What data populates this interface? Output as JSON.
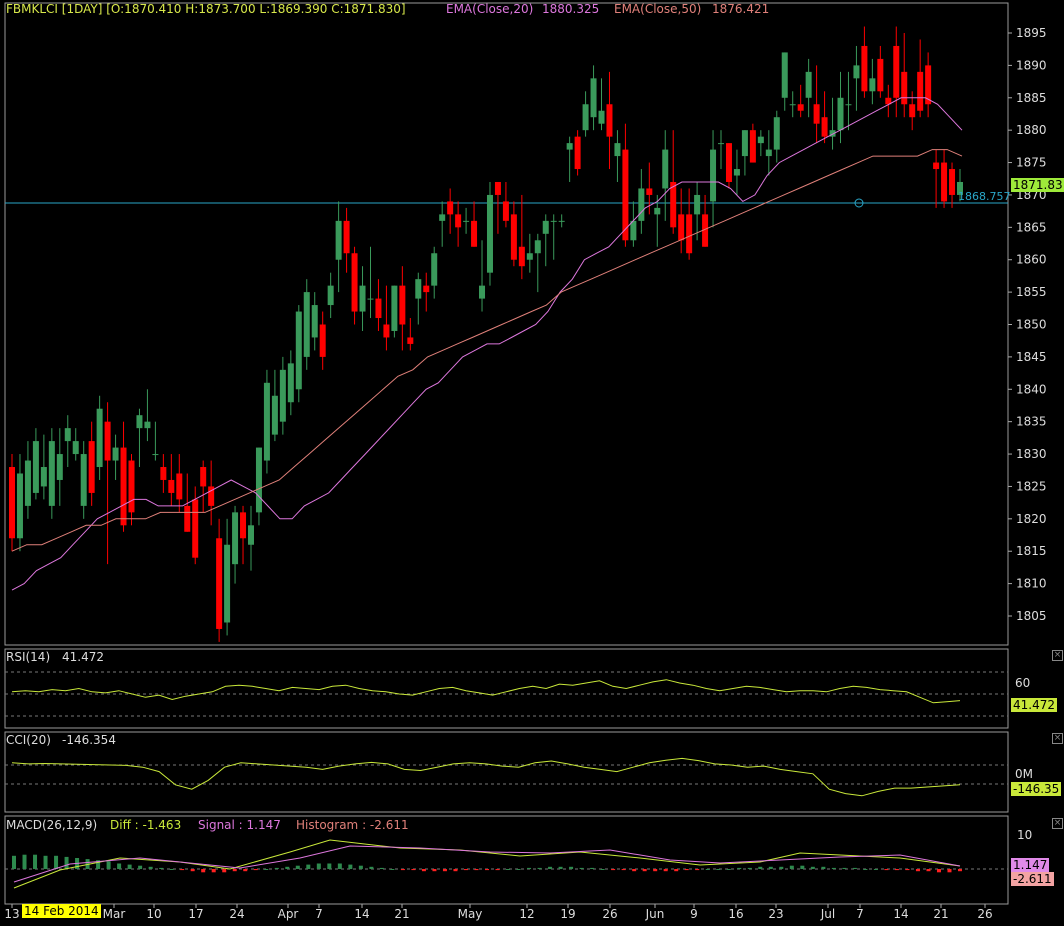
{
  "header": {
    "symbol_ohlc": "FBMKLCI [1DAY] [O:1870.410 H:1873.700 L:1869.390 C:1871.830]",
    "ema20_label": "EMA(Close,20)",
    "ema20_value": "1880.325",
    "ema50_label": "EMA(Close,50)",
    "ema50_value": "1876.421"
  },
  "price_tag": "1871.83",
  "hline_tag": "1868.757",
  "rsi": {
    "label": "RSI(14)",
    "value": "41.472",
    "tick": "60",
    "tag": "41.472"
  },
  "cci": {
    "label": "CCI(20)",
    "value": "-146.354",
    "tick": "0M",
    "tag": "-146.35"
  },
  "macd": {
    "label": "MACD(26,12,9)",
    "diff_label": "Diff : -1.463",
    "signal_label": "Signal : 1.147",
    "hist_label": "Histogram : -2.611",
    "tick": "10",
    "signal_tag": "1.147",
    "diff_tag": "-2.611"
  },
  "date_marker": "14 Feb 2014",
  "colors": {
    "up": "#3a9a5b",
    "down": "#ff0000",
    "ema20": "#dd77dd",
    "ema50": "#e0807a",
    "rsi": "#c9e83a",
    "hline": "#2aa6c8",
    "price_tag": "#9eea3a"
  },
  "chart_data": {
    "type": "candlestick",
    "title": "FBMKLCI [1DAY]",
    "price_axis_ticks": [
      "1895",
      "1890",
      "1885",
      "1880",
      "1875",
      "1870",
      "1865",
      "1860",
      "1855",
      "1850",
      "1845",
      "1840",
      "1835",
      "1830",
      "1825",
      "1820",
      "1815",
      "1810",
      "1805"
    ],
    "date_axis_ticks": [
      "13",
      "Mar",
      "10",
      "17",
      "24",
      "Apr",
      "7",
      "14",
      "21",
      "May",
      "12",
      "19",
      "26",
      "Jun",
      "9",
      "16",
      "23",
      "Jul",
      "7",
      "14",
      "21",
      "26"
    ],
    "ylim": [
      1800,
      1897
    ],
    "horizontal_line": 1868.757,
    "series": [
      {
        "name": "EMA(Close,20)",
        "last": 1880.325
      },
      {
        "name": "EMA(Close,50)",
        "last": 1876.421
      }
    ],
    "ohlc": [
      [
        1828,
        1830,
        1815,
        1817
      ],
      [
        1817,
        1830,
        1815,
        1827
      ],
      [
        1822,
        1832,
        1820,
        1829
      ],
      [
        1824,
        1834,
        1823,
        1832
      ],
      [
        1825,
        1833,
        1823,
        1828
      ],
      [
        1822,
        1834,
        1820,
        1832
      ],
      [
        1826,
        1834,
        1822,
        1830
      ],
      [
        1832,
        1836,
        1828,
        1834
      ],
      [
        1830,
        1834,
        1829,
        1832
      ],
      [
        1822,
        1832,
        1820,
        1830
      ],
      [
        1832,
        1835,
        1822,
        1824
      ],
      [
        1828,
        1839,
        1826,
        1837
      ],
      [
        1835,
        1838,
        1813,
        1829
      ],
      [
        1829,
        1833,
        1826,
        1831
      ],
      [
        1831,
        1835,
        1818,
        1819
      ],
      [
        1829,
        1830,
        1819,
        1821
      ],
      [
        1834,
        1837,
        1828,
        1836
      ],
      [
        1834,
        1840,
        1832,
        1835
      ],
      [
        1830,
        1835,
        1829,
        1830
      ],
      [
        1828,
        1830,
        1824,
        1826
      ],
      [
        1826,
        1830,
        1822,
        1824
      ],
      [
        1827,
        1830,
        1821,
        1823
      ],
      [
        1822,
        1827,
        1818,
        1818
      ],
      [
        1823,
        1825,
        1813,
        1814
      ],
      [
        1828,
        1829,
        1821,
        1825
      ],
      [
        1825,
        1829,
        1819,
        1822
      ],
      [
        1817,
        1820,
        1801,
        1803
      ],
      [
        1804,
        1820,
        1802,
        1816
      ],
      [
        1813,
        1822,
        1810,
        1821
      ],
      [
        1821,
        1822,
        1813,
        1817
      ],
      [
        1816,
        1822,
        1812,
        1819
      ],
      [
        1821,
        1831,
        1819,
        1831
      ],
      [
        1829,
        1843,
        1827,
        1841
      ],
      [
        1833,
        1843,
        1832,
        1839
      ],
      [
        1835,
        1845,
        1833,
        1843
      ],
      [
        1838,
        1846,
        1836,
        1844
      ],
      [
        1840,
        1853,
        1838,
        1852
      ],
      [
        1845,
        1857,
        1843,
        1855
      ],
      [
        1848,
        1855,
        1846,
        1853
      ],
      [
        1850,
        1852,
        1843,
        1845
      ],
      [
        1853,
        1858,
        1851,
        1856
      ],
      [
        1860,
        1869,
        1855,
        1866
      ],
      [
        1866,
        1868,
        1858,
        1861
      ],
      [
        1861,
        1862,
        1850,
        1852
      ],
      [
        1852,
        1859,
        1849,
        1856
      ],
      [
        1854,
        1862,
        1851,
        1854
      ],
      [
        1854,
        1857,
        1849,
        1851
      ],
      [
        1850,
        1856,
        1846,
        1848
      ],
      [
        1849,
        1856,
        1848,
        1856
      ],
      [
        1856,
        1859,
        1846,
        1850
      ],
      [
        1848,
        1851,
        1846,
        1847
      ],
      [
        1854,
        1858,
        1850,
        1857
      ],
      [
        1856,
        1858,
        1852,
        1855
      ],
      [
        1856,
        1862,
        1854,
        1861
      ],
      [
        1866,
        1869,
        1862,
        1867
      ],
      [
        1869,
        1871,
        1864,
        1867
      ],
      [
        1867,
        1869,
        1862,
        1865
      ],
      [
        1866,
        1868,
        1864,
        1866
      ],
      [
        1866,
        1869,
        1862,
        1862
      ],
      [
        1854,
        1863,
        1852,
        1856
      ],
      [
        1858,
        1872,
        1856,
        1870
      ],
      [
        1872,
        1872,
        1864,
        1870
      ],
      [
        1869,
        1872,
        1865,
        1866
      ],
      [
        1867,
        1869,
        1859,
        1860
      ],
      [
        1862,
        1870,
        1857,
        1859
      ],
      [
        1860,
        1864,
        1858,
        1861
      ],
      [
        1861,
        1864,
        1855,
        1863
      ],
      [
        1864,
        1867,
        1859,
        1866
      ],
      [
        1866,
        1867,
        1860,
        1866
      ],
      [
        1866,
        1867,
        1865,
        1866
      ],
      [
        1877,
        1879,
        1872,
        1878
      ],
      [
        1879,
        1880,
        1873,
        1874
      ],
      [
        1880,
        1886,
        1879,
        1884
      ],
      [
        1882,
        1890,
        1880,
        1888
      ],
      [
        1881,
        1888,
        1880,
        1883
      ],
      [
        1884,
        1889,
        1874,
        1879
      ],
      [
        1876,
        1880,
        1872,
        1878
      ],
      [
        1877,
        1881,
        1862,
        1863
      ],
      [
        1863,
        1869,
        1862,
        1866
      ],
      [
        1866,
        1874,
        1864,
        1871
      ],
      [
        1871,
        1875,
        1867,
        1870
      ],
      [
        1867,
        1870,
        1862,
        1868
      ],
      [
        1871,
        1880,
        1866,
        1877
      ],
      [
        1872,
        1880,
        1864,
        1865
      ],
      [
        1867,
        1871,
        1861,
        1863
      ],
      [
        1867,
        1871,
        1860,
        1861
      ],
      [
        1867,
        1872,
        1863,
        1870
      ],
      [
        1867,
        1870,
        1862,
        1862
      ],
      [
        1869,
        1880,
        1865,
        1877
      ],
      [
        1878,
        1880,
        1874,
        1878
      ],
      [
        1878,
        1878,
        1871,
        1872
      ],
      [
        1873,
        1877,
        1870,
        1874
      ],
      [
        1876,
        1880,
        1873,
        1880
      ],
      [
        1880,
        1881,
        1875,
        1875
      ],
      [
        1878,
        1880,
        1876,
        1879
      ],
      [
        1876,
        1880,
        1873,
        1877
      ],
      [
        1877,
        1883,
        1875,
        1882
      ],
      [
        1885,
        1892,
        1883,
        1892
      ],
      [
        1884,
        1886,
        1882,
        1884
      ],
      [
        1884,
        1887,
        1882,
        1883
      ],
      [
        1885,
        1891,
        1882,
        1889
      ],
      [
        1884,
        1890,
        1878,
        1881
      ],
      [
        1882,
        1886,
        1878,
        1879
      ],
      [
        1879,
        1885,
        1877,
        1880
      ],
      [
        1880,
        1889,
        1878,
        1885
      ],
      [
        1884,
        1889,
        1880,
        1884
      ],
      [
        1888,
        1893,
        1883,
        1890
      ],
      [
        1893,
        1896,
        1885,
        1886
      ],
      [
        1886,
        1891,
        1884,
        1888
      ],
      [
        1891,
        1893,
        1885,
        1886
      ],
      [
        1885,
        1887,
        1882,
        1884
      ],
      [
        1893,
        1896,
        1882,
        1885
      ],
      [
        1889,
        1895,
        1882,
        1884
      ],
      [
        1884,
        1886,
        1880,
        1882
      ],
      [
        1889,
        1894,
        1882,
        1883
      ],
      [
        1890,
        1892,
        1882,
        1884
      ],
      [
        1875,
        1877,
        1868,
        1874
      ],
      [
        1875,
        1877,
        1868,
        1869
      ],
      [
        1874,
        1875,
        1868,
        1870
      ],
      [
        1870,
        1874,
        1869,
        1872
      ]
    ],
    "ema20": [
      1809,
      1810,
      1812,
      1813,
      1814,
      1816,
      1818,
      1820,
      1821,
      1822,
      1823,
      1823,
      1822,
      1822,
      1822,
      1823,
      1824,
      1825,
      1826,
      1825,
      1824,
      1822,
      1820,
      1820,
      1822,
      1823,
      1824,
      1826,
      1828,
      1830,
      1832,
      1834,
      1836,
      1838,
      1840,
      1841,
      1843,
      1845,
      1846,
      1847,
      1847,
      1848,
      1849,
      1850,
      1852,
      1855,
      1857,
      1860,
      1861,
      1862,
      1864,
      1866,
      1868,
      1869,
      1871,
      1872,
      1872,
      1872,
      1872,
      1871,
      1869,
      1870,
      1873,
      1875,
      1876,
      1877,
      1878,
      1879,
      1880,
      1881,
      1882,
      1883,
      1884,
      1885,
      1885,
      1885,
      1884,
      1882,
      1880
    ],
    "ema50": [
      1815,
      1816,
      1816,
      1817,
      1818,
      1819,
      1819,
      1820,
      1820,
      1820,
      1821,
      1821,
      1821,
      1821,
      1822,
      1823,
      1824,
      1825,
      1826,
      1828,
      1830,
      1832,
      1834,
      1836,
      1838,
      1840,
      1842,
      1843,
      1845,
      1846,
      1847,
      1848,
      1849,
      1850,
      1851,
      1852,
      1853,
      1855,
      1856,
      1857,
      1858,
      1859,
      1860,
      1861,
      1862,
      1863,
      1864,
      1865,
      1866,
      1867,
      1868,
      1869,
      1870,
      1871,
      1872,
      1873,
      1874,
      1875,
      1876,
      1876,
      1876,
      1876,
      1877,
      1877,
      1876
    ],
    "rsi_values": [
      52,
      53,
      52,
      54,
      53,
      55,
      52,
      51,
      53,
      50,
      47,
      49,
      45,
      48,
      50,
      52,
      57,
      58,
      57,
      55,
      53,
      56,
      55,
      54,
      57,
      58,
      55,
      53,
      52,
      50,
      49,
      52,
      55,
      56,
      53,
      51,
      49,
      52,
      55,
      57,
      55,
      59,
      58,
      60,
      62,
      57,
      55,
      58,
      61,
      63,
      60,
      58,
      55,
      53,
      55,
      57,
      56,
      54,
      52,
      53,
      53,
      52,
      55,
      57,
      56,
      54,
      53,
      52,
      47,
      42,
      43,
      44
    ],
    "cci_values": [
      60,
      55,
      57,
      55,
      53,
      52,
      50,
      48,
      40,
      20,
      -40,
      -60,
      -20,
      40,
      60,
      55,
      50,
      45,
      40,
      30,
      45,
      55,
      62,
      55,
      30,
      25,
      40,
      55,
      60,
      55,
      45,
      40,
      60,
      68,
      55,
      40,
      30,
      20,
      40,
      60,
      72,
      80,
      70,
      55,
      50,
      40,
      45,
      30,
      20,
      10,
      -60,
      -80,
      -90,
      -70,
      -55,
      -55,
      -50,
      -45,
      -40
    ]
  }
}
